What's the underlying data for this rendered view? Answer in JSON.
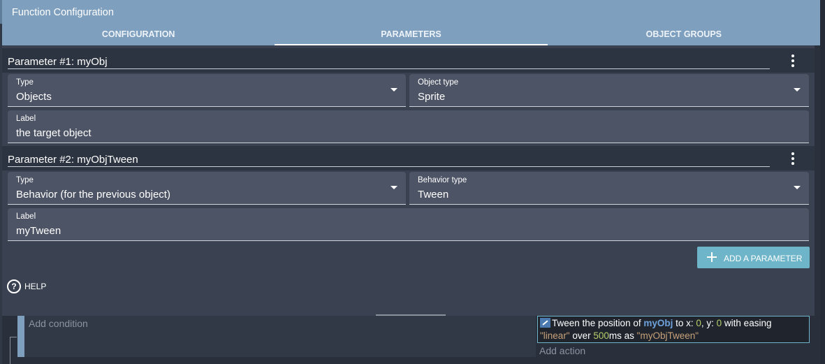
{
  "window": {
    "title": "Function Configuration"
  },
  "tabs": [
    {
      "label": "CONFIGURATION",
      "active": false
    },
    {
      "label": "PARAMETERS",
      "active": true
    },
    {
      "label": "OBJECT GROUPS",
      "active": false
    }
  ],
  "parameters": [
    {
      "heading": "Parameter #1: myObj",
      "type_label": "Type",
      "type_value": "Objects",
      "subtype_label": "Object type",
      "subtype_value": "Sprite",
      "label_label": "Label",
      "label_value": "the target object"
    },
    {
      "heading": "Parameter #2: myObjTween",
      "type_label": "Type",
      "type_value": "Behavior (for the previous object)",
      "subtype_label": "Behavior type",
      "subtype_value": "Tween",
      "label_label": "Label",
      "label_value": "myTween"
    }
  ],
  "add_parameter_label": "ADD A PARAMETER",
  "help": {
    "icon": "?",
    "label": "HELP"
  },
  "events": {
    "add_condition": "Add condition",
    "add_action": "Add action",
    "action": {
      "icon": "tween-icon",
      "t1": "Tween the position of ",
      "object": "myObj",
      "t2": " to x: ",
      "x": "0",
      "t3": ", y: ",
      "y": "0",
      "t4": " with easing",
      "easing": "\"linear\"",
      "t5": " over ",
      "duration": "500",
      "t6": "ms as ",
      "tween_name": "\"myObjTween\""
    }
  },
  "colors": {
    "header": "#7f9fbf",
    "panel": "#3a4252",
    "field": "#4d5465",
    "accent": "#6fb5c9",
    "object_highlight": "#6fa2db",
    "number_highlight": "#b5cf6b",
    "string_highlight": "#c9a27a"
  }
}
